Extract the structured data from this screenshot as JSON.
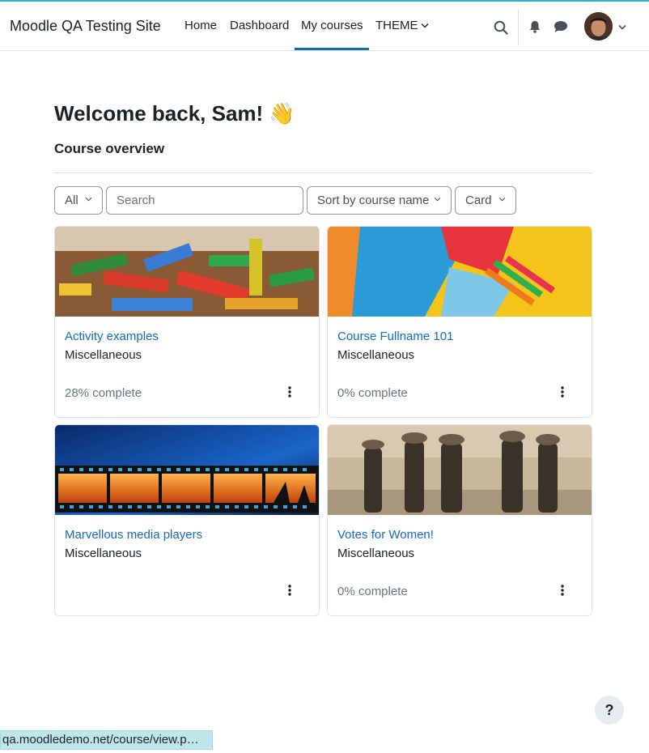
{
  "site": {
    "brand": "Moodle QA Testing Site"
  },
  "nav": {
    "items": [
      {
        "label": "Home"
      },
      {
        "label": "Dashboard"
      },
      {
        "label": "My courses"
      },
      {
        "label": "THEME"
      }
    ],
    "active": "My courses",
    "icons": [
      "search-icon",
      "bell-icon",
      "chat-icon",
      "chevron-down-icon"
    ]
  },
  "main": {
    "welcome": "Welcome back, Sam! 👋",
    "section_title": "Course overview",
    "filters": {
      "grouping": "All",
      "search_placeholder": "Search",
      "sort": "Sort by course name",
      "view": "Card"
    },
    "courses": [
      {
        "title": "Activity examples",
        "category": "Miscellaneous",
        "progress": "28% complete"
      },
      {
        "title": "Course Fullname 101",
        "category": "Miscellaneous",
        "progress": "0% complete"
      },
      {
        "title": "Marvellous media players",
        "category": "Miscellaneous",
        "progress": ""
      },
      {
        "title": "Votes for Women!",
        "category": "Miscellaneous",
        "progress": "0% complete"
      }
    ]
  },
  "help_button": "?",
  "status_url": "qa.moodledemo.net/course/view.p…",
  "colors": {
    "accent": "#0f6cbf",
    "text": "#1d2125",
    "muted": "#6a737b",
    "border": "#dee2e6",
    "topline": "#2fb3c9"
  }
}
